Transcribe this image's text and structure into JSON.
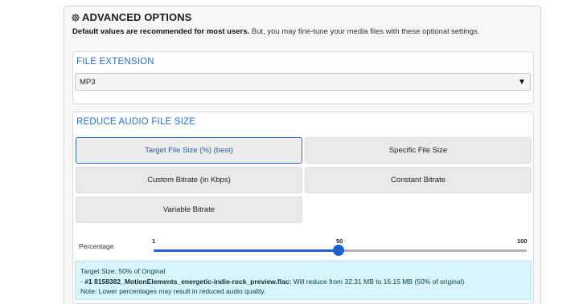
{
  "header": {
    "title": "ADVANCED OPTIONS",
    "subtitle_bold": "Default values are recommended for most users.",
    "subtitle_rest": " But, you may fine-tune your media files with these optional settings."
  },
  "file_extension": {
    "title": "FILE EXTENSION",
    "selected": "MP3"
  },
  "reduce": {
    "title": "REDUCE AUDIO FILE SIZE",
    "options": [
      {
        "label": "Target File Size (%) (best)",
        "active": true
      },
      {
        "label": "Specific File Size",
        "active": false
      },
      {
        "label": "Custom Bitrate (in Kbps)",
        "active": false
      },
      {
        "label": "Constant Bitrate",
        "active": false
      },
      {
        "label": "Variable Bitrate",
        "active": false
      }
    ],
    "slider": {
      "label": "Percentage",
      "min": 1,
      "max": 100,
      "value": 50,
      "min_label": "1",
      "mid_label": "50",
      "max_label": "100"
    },
    "info": {
      "line1": "Target Size: 50% of Original",
      "line2_prefix": "- ",
      "line2_file": "#1 8158382_MotionElements_energetic-indie-rock_preview.flac:",
      "line2_rest": " Will reduce from 32.31 MB to 16.15 MB (50% of original)",
      "line3": "Note: Lower percentages may result in reduced audio quality."
    }
  },
  "colors": {
    "accent": "#2a6fd1",
    "slider": "#1f5fd0",
    "info_bg": "#d7f5fb"
  },
  "icons": {
    "header": "gear-icon",
    "select": "triangle-down-icon"
  }
}
